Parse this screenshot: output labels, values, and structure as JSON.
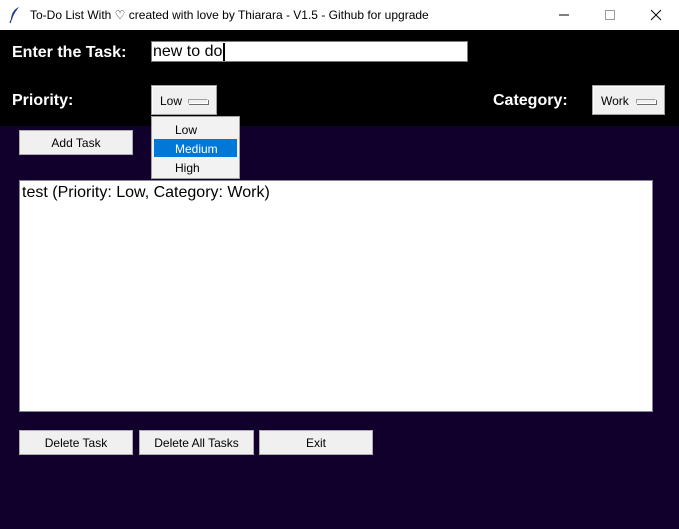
{
  "window": {
    "title": "To-Do List With ♡ created with love by Thiarara - V1.5 - Github for upgrade"
  },
  "form": {
    "task_label": "Enter the Task:",
    "task_value": "new to do",
    "priority_label": "Priority:",
    "priority_value": "Low",
    "category_label": "Category:",
    "category_value": "Work"
  },
  "priority_dropdown": {
    "options": [
      "Low",
      "Medium",
      "High"
    ],
    "highlighted": "Medium"
  },
  "buttons": {
    "add": "Add Task",
    "delete": "Delete Task",
    "delete_all": "Delete All Tasks",
    "exit": "Exit"
  },
  "tasks": [
    "test (Priority: Low, Category: Work)"
  ],
  "colors": {
    "background": "#10002b",
    "header": "#000000",
    "highlight": "#0078d7"
  },
  "icons": {
    "app": "feather-icon",
    "minimize": "minimize-icon",
    "maximize": "maximize-icon",
    "close": "close-icon"
  }
}
